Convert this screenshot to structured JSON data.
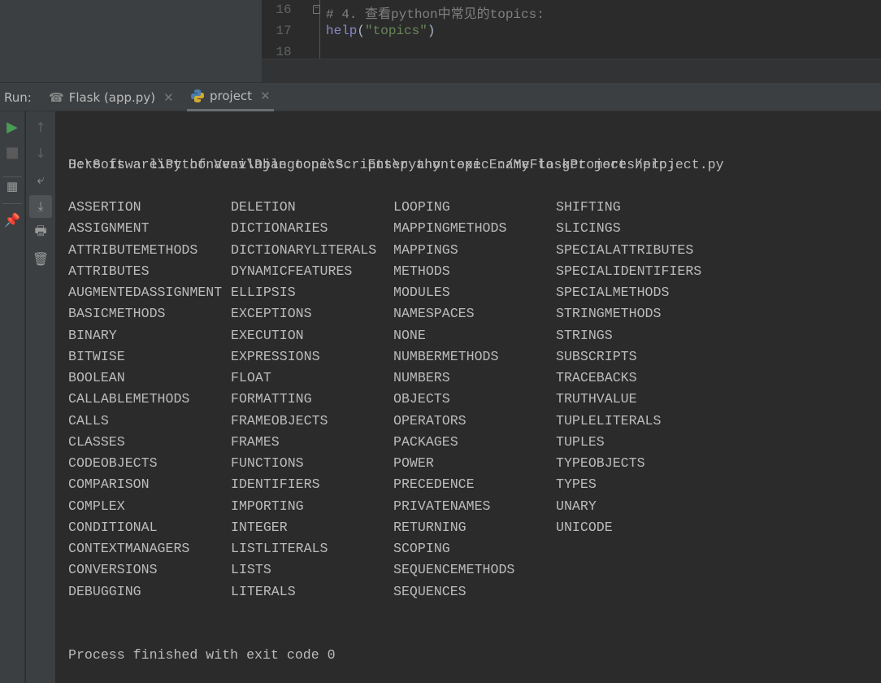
{
  "editor": {
    "lines": [
      {
        "number": "16",
        "code": "# 4. 查看python中常见的topics:"
      },
      {
        "number": "17",
        "code_fn": "help",
        "code_paren_open": "(",
        "code_str": "\"topics\"",
        "code_paren_close": ")"
      },
      {
        "number": "18",
        "code": ""
      }
    ]
  },
  "run": {
    "label": "Run:",
    "tabs": [
      {
        "label": "Flask (app.py)",
        "icon": "flask-icon"
      },
      {
        "label": "project",
        "icon": "python-icon",
        "active": true
      }
    ]
  },
  "toolbar": {
    "icons": [
      "run-icon",
      "stop-icon",
      "layout-icon",
      "pin-icon",
      "scroll-up-icon",
      "scroll-down-icon",
      "soft-wrap-icon",
      "scroll-to-end-icon",
      "print-icon",
      "trash-icon"
    ]
  },
  "colors": {
    "run": "#499c54",
    "comment": "#808080",
    "string": "#6a8759",
    "function": "#8888c6"
  },
  "console": {
    "command": "D:\\Software\\PythonVenv\\Djangoone\\Scripts\\python.exe E:/MyFlaskProjects/project.py",
    "intro": "Here is a list of available topics.  Enter any topic name to get more help.",
    "topic_columns": [
      [
        "ASSERTION",
        "ASSIGNMENT",
        "ATTRIBUTEMETHODS",
        "ATTRIBUTES",
        "AUGMENTEDASSIGNMENT",
        "BASICMETHODS",
        "BINARY",
        "BITWISE",
        "BOOLEAN",
        "CALLABLEMETHODS",
        "CALLS",
        "CLASSES",
        "CODEOBJECTS",
        "COMPARISON",
        "COMPLEX",
        "CONDITIONAL",
        "CONTEXTMANAGERS",
        "CONVERSIONS",
        "DEBUGGING"
      ],
      [
        "DELETION",
        "DICTIONARIES",
        "DICTIONARYLITERALS",
        "DYNAMICFEATURES",
        "ELLIPSIS",
        "EXCEPTIONS",
        "EXECUTION",
        "EXPRESSIONS",
        "FLOAT",
        "FORMATTING",
        "FRAMEOBJECTS",
        "FRAMES",
        "FUNCTIONS",
        "IDENTIFIERS",
        "IMPORTING",
        "INTEGER",
        "LISTLITERALS",
        "LISTS",
        "LITERALS"
      ],
      [
        "LOOPING",
        "MAPPINGMETHODS",
        "MAPPINGS",
        "METHODS",
        "MODULES",
        "NAMESPACES",
        "NONE",
        "NUMBERMETHODS",
        "NUMBERS",
        "OBJECTS",
        "OPERATORS",
        "PACKAGES",
        "POWER",
        "PRECEDENCE",
        "PRIVATENAMES",
        "RETURNING",
        "SCOPING",
        "SEQUENCEMETHODS",
        "SEQUENCES"
      ],
      [
        "SHIFTING",
        "SLICINGS",
        "SPECIALATTRIBUTES",
        "SPECIALIDENTIFIERS",
        "SPECIALMETHODS",
        "STRINGMETHODS",
        "STRINGS",
        "SUBSCRIPTS",
        "TRACEBACKS",
        "TRUTHVALUE",
        "TUPLELITERALS",
        "TUPLES",
        "TYPEOBJECTS",
        "TYPES",
        "UNARY",
        "UNICODE"
      ]
    ],
    "exit": "Process finished with exit code 0"
  }
}
